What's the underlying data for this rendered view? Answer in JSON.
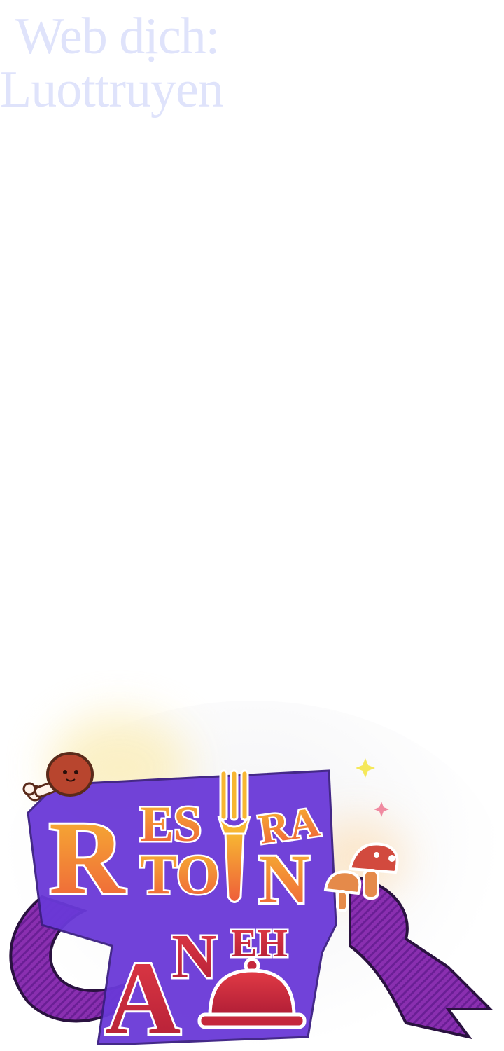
{
  "watermark": {
    "line1": "Web dịch:",
    "line2": "Luottruyen"
  },
  "logo": {
    "letters": {
      "r": "R",
      "es": "ES",
      "ra": "RA",
      "to": "TO",
      "n": "N",
      "a": "A",
      "n2": "N",
      "eh": "EH"
    },
    "colors": {
      "ribbon": "#8a2fb0",
      "ribbon_dark": "#5d1a86",
      "outline_purple": "#6a39d8",
      "letter_fill_orange": "#f0742f",
      "letter_fill_yellow": "#f7b632",
      "letter_fill_red": "#c5273c",
      "sparkle_yellow": "#f5e85a",
      "sparkle_pink": "#f08aa0"
    },
    "icons": [
      "drumstick-icon",
      "fork-icon",
      "mushroom-icon",
      "cloche-icon",
      "sparkle-icon"
    ]
  }
}
